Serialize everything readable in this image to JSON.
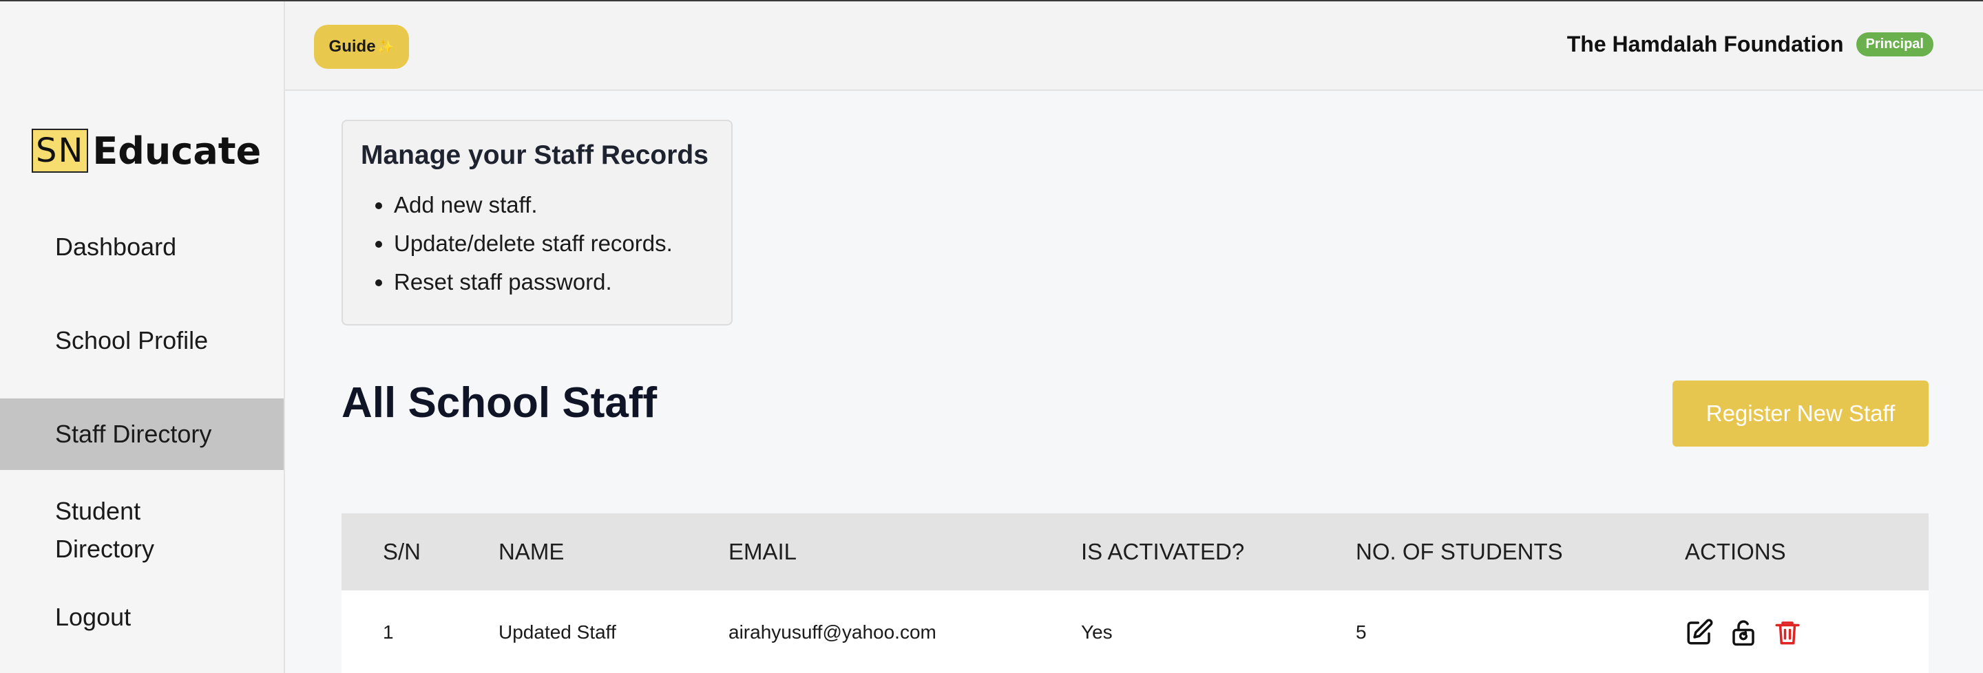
{
  "logo": {
    "prefix": "SN",
    "name": "Educate"
  },
  "nav": [
    {
      "label": "Dashboard"
    },
    {
      "label": "School Profile"
    },
    {
      "label": "Staff Directory",
      "active": true
    },
    {
      "label": "Student Directory"
    },
    {
      "label": "Logout"
    }
  ],
  "topbar": {
    "guide_label": "Guide",
    "guide_icon": "sparkle-icon",
    "org_name": "The Hamdalah Foundation",
    "role": "Principal"
  },
  "info": {
    "title": "Manage your Staff Records",
    "items": [
      "Add new staff.",
      "Update/delete staff records.",
      "Reset staff password."
    ]
  },
  "section_title": "All School Staff",
  "register_label": "Register New Staff",
  "table": {
    "headers": [
      "S/N",
      "NAME",
      "EMAIL",
      "IS ACTIVATED?",
      "NO. OF STUDENTS",
      "ACTIONS"
    ],
    "rows": [
      {
        "sn": "1",
        "name": "Updated Staff",
        "email": "airahyusuff@yahoo.com",
        "activated": "Yes",
        "students": "5"
      }
    ]
  },
  "colors": {
    "accent": "#e7c64f",
    "badge": "#6ab04c",
    "delete": "#e02424",
    "active_nav": "#c4c4c4"
  }
}
